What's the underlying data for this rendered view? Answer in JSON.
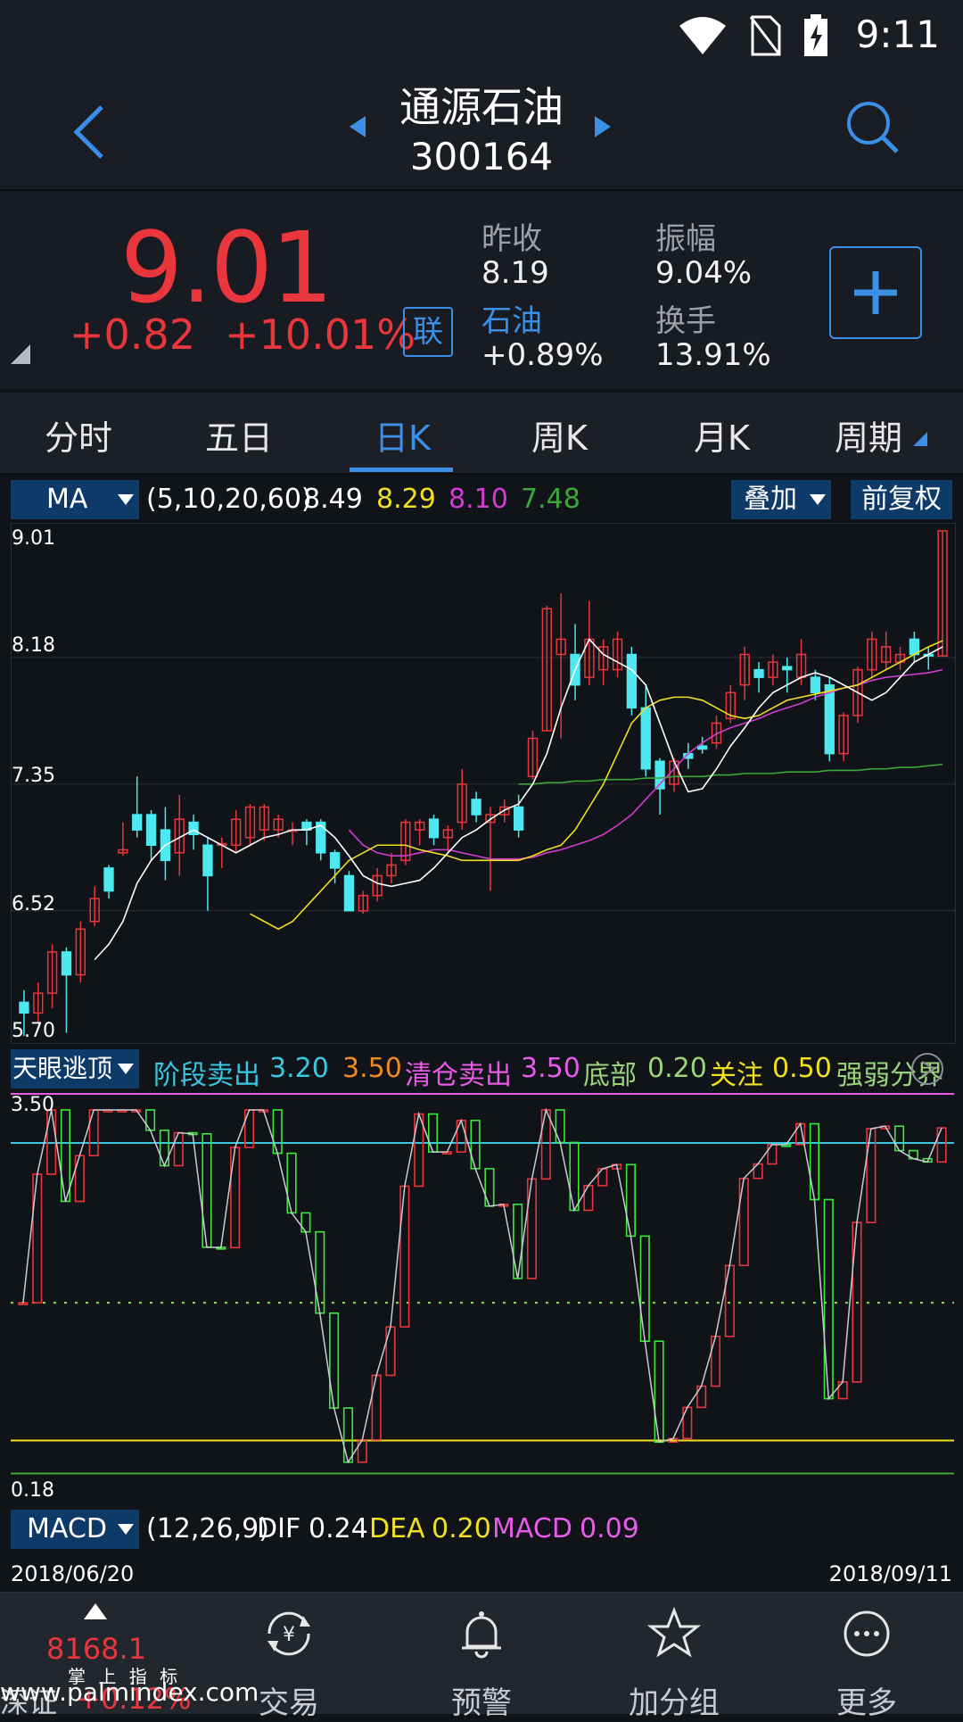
{
  "status": {
    "time": "9:11"
  },
  "header": {
    "name": "通源石油",
    "code": "300164"
  },
  "quote": {
    "price": "9.01",
    "change": "+0.82",
    "change_pct": "+10.01%",
    "lian": "联",
    "prev_close_label": "昨收",
    "prev_close": "8.19",
    "sector_label": "石油",
    "sector_change": "+0.89%",
    "amplitude_label": "振幅",
    "amplitude": "9.04%",
    "turnover_label": "换手",
    "turnover": "13.91%"
  },
  "tabs": [
    {
      "label": "分时"
    },
    {
      "label": "五日"
    },
    {
      "label": "日K"
    },
    {
      "label": "周K"
    },
    {
      "label": "月K"
    },
    {
      "label": "周期"
    }
  ],
  "ma_bar": {
    "dropdown": "MA",
    "params": "(5,10,20,60)",
    "v1": "8.49",
    "v2": "8.29",
    "v3": "8.10",
    "v4": "7.48",
    "overlay": "叠加",
    "adjust": "前复权"
  },
  "main_axis": {
    "labels": [
      "9.01",
      "8.18",
      "7.35",
      "6.52",
      "5.70"
    ]
  },
  "sub_bar": {
    "dropdown": "天眼逃顶",
    "t1": "阶段卖出",
    "v1": "3.20",
    "v2": "3.50",
    "t2": "清仓卖出",
    "v3": "3.50",
    "t3": "底部",
    "v4": "0.20",
    "t4": "关注",
    "v5": "0.50",
    "t5": "强弱分界"
  },
  "sub_axis": {
    "top": "3.50",
    "bottom": "0.18"
  },
  "macd_bar": {
    "dropdown": "MACD",
    "params": "(12,26,9)",
    "dif_label": "DIF",
    "dif": "0.24",
    "dea_label": "DEA",
    "dea": "0.20",
    "macd_label": "MACD",
    "macd": "0.09"
  },
  "dates": {
    "start": "2018/06/20",
    "end": "2018/09/11"
  },
  "nav": {
    "index_value": "8168.1",
    "index_change": "+0.12%",
    "index_name": "深证",
    "items": [
      {
        "label": "交易"
      },
      {
        "label": "预警"
      },
      {
        "label": "加分组"
      },
      {
        "label": "更多"
      }
    ]
  },
  "watermark": "www.palmindex.com",
  "watermark_sub": "掌 上 指 标",
  "colors": {
    "up": "#e8363c",
    "down": "#4de8f0",
    "accent": "#3b8fe6",
    "ma5": "#ffffff",
    "ma10": "#f0e020",
    "ma20": "#d23cd2",
    "ma60": "#3ca83c"
  },
  "chart_data": {
    "type": "candlestick",
    "ylim": [
      5.7,
      9.01
    ],
    "candles": [
      {
        "o": 5.92,
        "c": 5.85,
        "h": 6.0,
        "l": 5.7
      },
      {
        "o": 5.85,
        "c": 5.98,
        "h": 6.05,
        "l": 5.78
      },
      {
        "o": 5.98,
        "c": 6.25,
        "h": 6.3,
        "l": 5.88
      },
      {
        "o": 6.25,
        "c": 6.1,
        "h": 6.28,
        "l": 5.72
      },
      {
        "o": 6.1,
        "c": 6.4,
        "h": 6.45,
        "l": 6.05
      },
      {
        "o": 6.45,
        "c": 6.6,
        "h": 6.68,
        "l": 6.42
      },
      {
        "o": 6.8,
        "c": 6.65,
        "h": 6.82,
        "l": 6.6
      },
      {
        "o": 6.9,
        "c": 6.92,
        "h": 7.1,
        "l": 6.88
      },
      {
        "o": 7.15,
        "c": 7.05,
        "h": 7.4,
        "l": 7.0
      },
      {
        "o": 7.15,
        "c": 6.95,
        "h": 7.18,
        "l": 6.85
      },
      {
        "o": 7.05,
        "c": 6.85,
        "h": 7.2,
        "l": 6.72
      },
      {
        "o": 6.9,
        "c": 7.12,
        "h": 7.28,
        "l": 6.75
      },
      {
        "o": 7.1,
        "c": 7.02,
        "h": 7.15,
        "l": 6.92
      },
      {
        "o": 6.95,
        "c": 6.75,
        "h": 7.0,
        "l": 6.52
      },
      {
        "o": 6.95,
        "c": 6.96,
        "h": 7.0,
        "l": 6.8
      },
      {
        "o": 6.95,
        "c": 7.12,
        "h": 7.18,
        "l": 6.9
      },
      {
        "o": 7.0,
        "c": 7.2,
        "h": 7.22,
        "l": 6.95
      },
      {
        "o": 7.05,
        "c": 7.2,
        "h": 7.22,
        "l": 6.98
      },
      {
        "o": 7.05,
        "c": 7.12,
        "h": 7.15,
        "l": 7.0
      },
      {
        "o": 7.05,
        "c": 7.05,
        "h": 7.1,
        "l": 6.95
      },
      {
        "o": 7.1,
        "c": 7.05,
        "h": 7.12,
        "l": 6.95
      },
      {
        "o": 7.1,
        "c": 6.9,
        "h": 7.12,
        "l": 6.85
      },
      {
        "o": 6.9,
        "c": 6.8,
        "h": 6.92,
        "l": 6.7
      },
      {
        "o": 6.75,
        "c": 6.52,
        "h": 6.78,
        "l": 6.52
      },
      {
        "o": 6.52,
        "c": 6.62,
        "h": 6.65,
        "l": 6.5
      },
      {
        "o": 6.62,
        "c": 6.75,
        "h": 6.8,
        "l": 6.58
      },
      {
        "o": 6.75,
        "c": 6.82,
        "h": 6.9,
        "l": 6.7
      },
      {
        "o": 6.85,
        "c": 7.1,
        "h": 7.12,
        "l": 6.82
      },
      {
        "o": 7.05,
        "c": 7.1,
        "h": 7.12,
        "l": 6.95
      },
      {
        "o": 7.12,
        "c": 7.0,
        "h": 7.15,
        "l": 6.95
      },
      {
        "o": 7.0,
        "c": 7.05,
        "h": 7.08,
        "l": 6.9
      },
      {
        "o": 7.1,
        "c": 7.35,
        "h": 7.45,
        "l": 7.05
      },
      {
        "o": 7.25,
        "c": 7.15,
        "h": 7.3,
        "l": 7.1
      },
      {
        "o": 7.1,
        "c": 7.15,
        "h": 7.2,
        "l": 6.65
      },
      {
        "o": 7.15,
        "c": 7.2,
        "h": 7.25,
        "l": 7.1
      },
      {
        "o": 7.2,
        "c": 7.05,
        "h": 7.28,
        "l": 7.0
      },
      {
        "o": 7.4,
        "c": 7.65,
        "h": 7.7,
        "l": 7.38
      },
      {
        "o": 7.7,
        "c": 8.5,
        "h": 8.52,
        "l": 7.7
      },
      {
        "o": 8.2,
        "c": 8.3,
        "h": 8.6,
        "l": 7.65
      },
      {
        "o": 8.2,
        "c": 8.0,
        "h": 8.4,
        "l": 7.9
      },
      {
        "o": 8.05,
        "c": 8.3,
        "h": 8.55,
        "l": 8.0
      },
      {
        "o": 8.1,
        "c": 8.25,
        "h": 8.3,
        "l": 8.0
      },
      {
        "o": 8.1,
        "c": 8.3,
        "h": 8.35,
        "l": 8.05
      },
      {
        "o": 8.2,
        "c": 7.85,
        "h": 8.25,
        "l": 7.8
      },
      {
        "o": 7.85,
        "c": 7.45,
        "h": 8.0,
        "l": 7.4
      },
      {
        "o": 7.5,
        "c": 7.32,
        "h": 7.52,
        "l": 7.15
      },
      {
        "o": 7.35,
        "c": 7.5,
        "h": 7.52,
        "l": 7.3
      },
      {
        "o": 7.55,
        "c": 7.52,
        "h": 7.62,
        "l": 7.45
      },
      {
        "o": 7.6,
        "c": 7.58,
        "h": 7.66,
        "l": 7.55
      },
      {
        "o": 7.62,
        "c": 7.75,
        "h": 7.8,
        "l": 7.58
      },
      {
        "o": 7.78,
        "c": 7.95,
        "h": 8.0,
        "l": 7.75
      },
      {
        "o": 8.0,
        "c": 8.2,
        "h": 8.25,
        "l": 7.9
      },
      {
        "o": 8.1,
        "c": 8.05,
        "h": 8.15,
        "l": 7.95
      },
      {
        "o": 8.05,
        "c": 8.15,
        "h": 8.2,
        "l": 8.0
      },
      {
        "o": 8.12,
        "c": 8.1,
        "h": 8.18,
        "l": 7.95
      },
      {
        "o": 8.05,
        "c": 8.2,
        "h": 8.3,
        "l": 8.0
      },
      {
        "o": 8.05,
        "c": 7.95,
        "h": 8.1,
        "l": 7.9
      },
      {
        "o": 8.0,
        "c": 7.55,
        "h": 8.05,
        "l": 7.5
      },
      {
        "o": 7.55,
        "c": 7.8,
        "h": 7.82,
        "l": 7.5
      },
      {
        "o": 7.8,
        "c": 8.1,
        "h": 8.12,
        "l": 7.75
      },
      {
        "o": 8.1,
        "c": 8.3,
        "h": 8.35,
        "l": 8.05
      },
      {
        "o": 8.15,
        "c": 8.25,
        "h": 8.35,
        "l": 8.1
      },
      {
        "o": 8.15,
        "c": 8.2,
        "h": 8.25,
        "l": 8.1
      },
      {
        "o": 8.3,
        "c": 8.2,
        "h": 8.35,
        "l": 8.15
      },
      {
        "o": 8.2,
        "c": 8.19,
        "h": 8.25,
        "l": 8.1
      },
      {
        "o": 8.19,
        "c": 9.01,
        "h": 9.01,
        "l": 8.19
      }
    ],
    "ma5": [
      6.2,
      6.3,
      6.45,
      6.7,
      6.85,
      6.95,
      7.0,
      7.05,
      7.0,
      6.95,
      6.9,
      6.95,
      7.0,
      7.02,
      7.05,
      7.05,
      7.08,
      7.0,
      6.88,
      6.75,
      6.7,
      6.68,
      6.7,
      6.72,
      6.8,
      6.9,
      7.0,
      7.05,
      7.12,
      7.18,
      7.22,
      7.35,
      7.55,
      7.85,
      8.1,
      8.3,
      8.2,
      8.15,
      8.1,
      8.0,
      7.75,
      7.5,
      7.3,
      7.32,
      7.45,
      7.6,
      7.72,
      7.85,
      7.95,
      8.0,
      8.05,
      8.08,
      8.05,
      8.0,
      7.95,
      7.9,
      7.95,
      8.05,
      8.15,
      8.2,
      8.25
    ],
    "ma10": [
      6.5,
      6.45,
      6.4,
      6.45,
      6.55,
      6.65,
      6.75,
      6.85,
      6.9,
      6.95,
      6.95,
      6.95,
      6.92,
      6.9,
      6.88,
      6.85,
      6.85,
      6.85,
      6.85,
      6.85,
      6.88,
      6.92,
      6.95,
      7.05,
      7.2,
      7.35,
      7.55,
      7.75,
      7.85,
      7.9,
      7.92,
      7.92,
      7.9,
      7.85,
      7.8,
      7.78,
      7.8,
      7.85,
      7.9,
      7.92,
      7.94,
      7.96,
      7.98,
      8.0,
      8.05,
      8.1,
      8.15,
      8.2,
      8.25,
      8.29
    ],
    "ma20": [
      7.05,
      6.95,
      6.9,
      6.88,
      6.88,
      6.9,
      6.92,
      6.92,
      6.9,
      6.88,
      6.86,
      6.86,
      6.86,
      6.87,
      6.9,
      6.92,
      6.95,
      6.98,
      7.02,
      7.08,
      7.15,
      7.25,
      7.35,
      7.45,
      7.55,
      7.62,
      7.68,
      7.72,
      7.75,
      7.78,
      7.82,
      7.85,
      7.88,
      7.92,
      7.95,
      7.98,
      8.0,
      8.03,
      8.05,
      8.06,
      8.07,
      8.08,
      8.1
    ],
    "ma60": [
      7.35,
      7.35,
      7.36,
      7.36,
      7.37,
      7.37,
      7.38,
      7.38,
      7.38,
      7.39,
      7.39,
      7.4,
      7.4,
      7.4,
      7.41,
      7.41,
      7.42,
      7.42,
      7.42,
      7.43,
      7.43,
      7.43,
      7.44,
      7.44,
      7.44,
      7.45,
      7.45,
      7.46,
      7.46,
      7.47,
      7.48
    ]
  }
}
